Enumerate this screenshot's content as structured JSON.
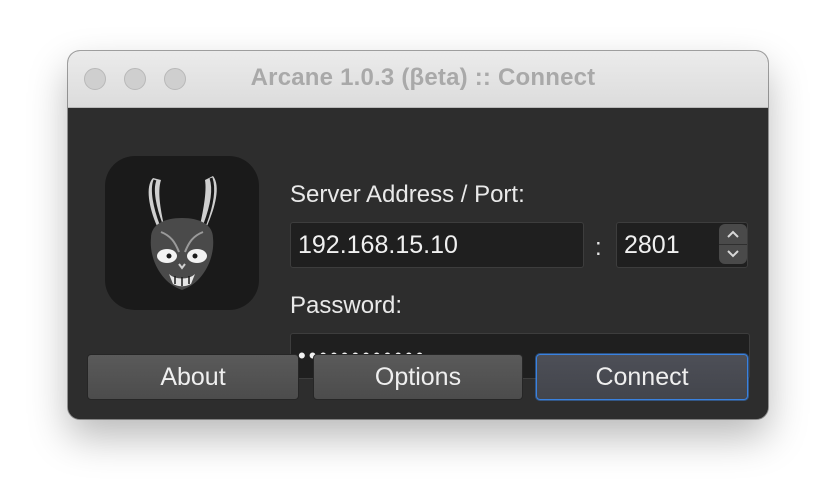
{
  "window": {
    "title": "Arcane 1.0.3 (βeta) :: Connect"
  },
  "form": {
    "server_label": "Server Address / Port:",
    "address_value": "192.168.15.10",
    "separator": ":",
    "port_value": "2801",
    "password_label": "Password:",
    "password_mask": "••••••••••••"
  },
  "buttons": {
    "about": "About",
    "options": "Options",
    "connect": "Connect"
  },
  "icons": {
    "app": "rabbit-mask-icon",
    "stepper_up": "chevron-up-icon",
    "stepper_down": "chevron-down-icon"
  },
  "colors": {
    "accent": "#3a82e0",
    "window_bg": "#2d2d2d",
    "field_bg": "#1f1f1f"
  }
}
